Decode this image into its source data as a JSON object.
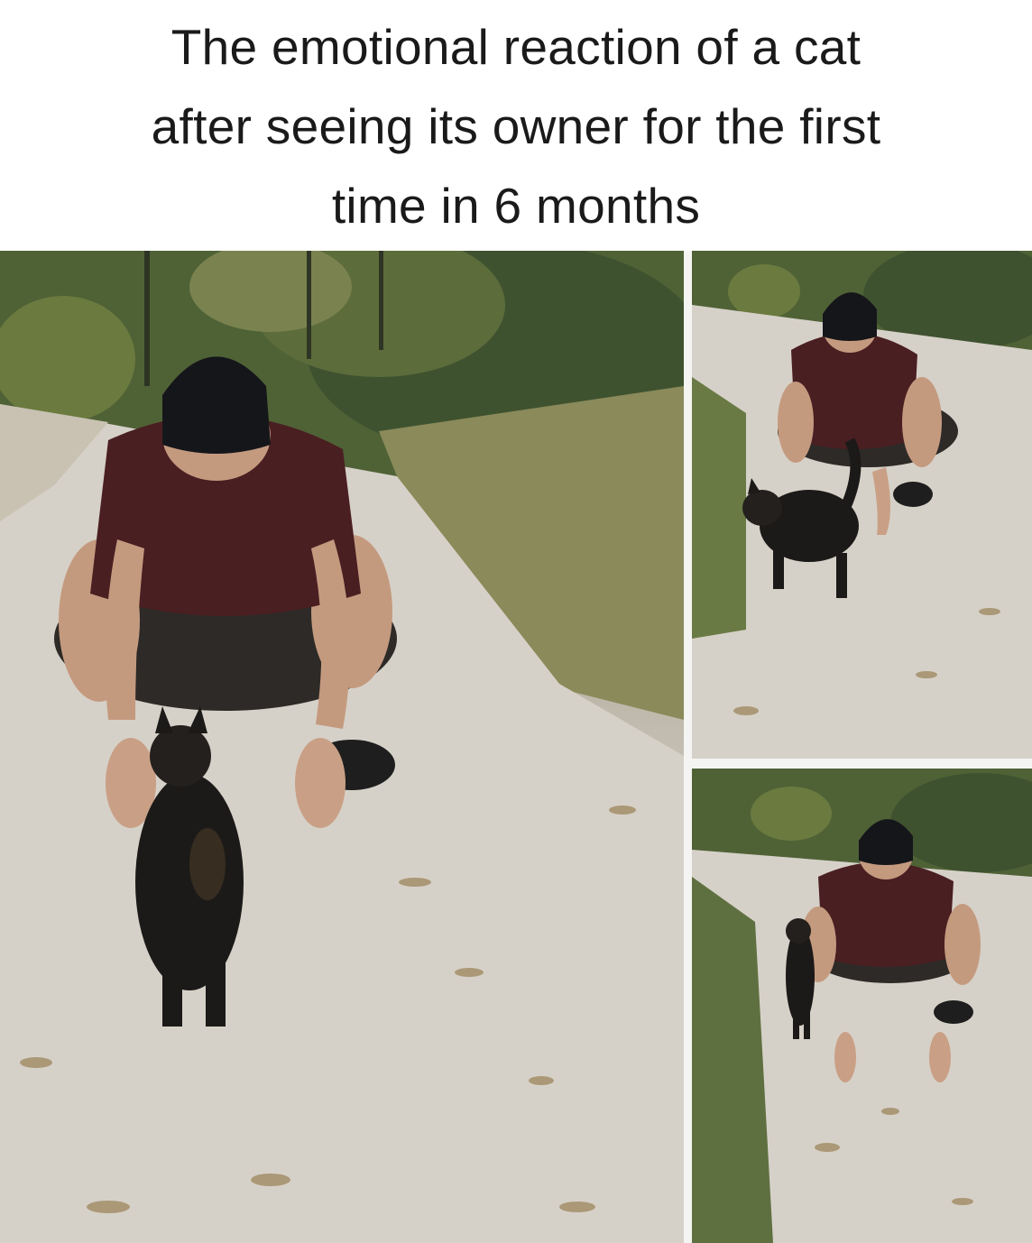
{
  "caption": {
    "lines": [
      "The emotional reaction of a cat",
      "after seeing its owner for the first",
      "time in 6 months"
    ]
  },
  "colors": {
    "background": "#ffffff",
    "text": "#1a1a1a",
    "shirt": "#4a1f22",
    "cap": "#15161a",
    "cat": "#1c1a18",
    "path": "#d9d4cc",
    "foliage": "#4f6236"
  },
  "photos": [
    {
      "name": "main-photo",
      "subject": "man crouching with open arms, cat walking past"
    },
    {
      "name": "top-right-photo",
      "subject": "man crouching, cat walking past his hand"
    },
    {
      "name": "bottom-right-photo",
      "subject": "man crouching, cat walking away behind him"
    }
  ]
}
